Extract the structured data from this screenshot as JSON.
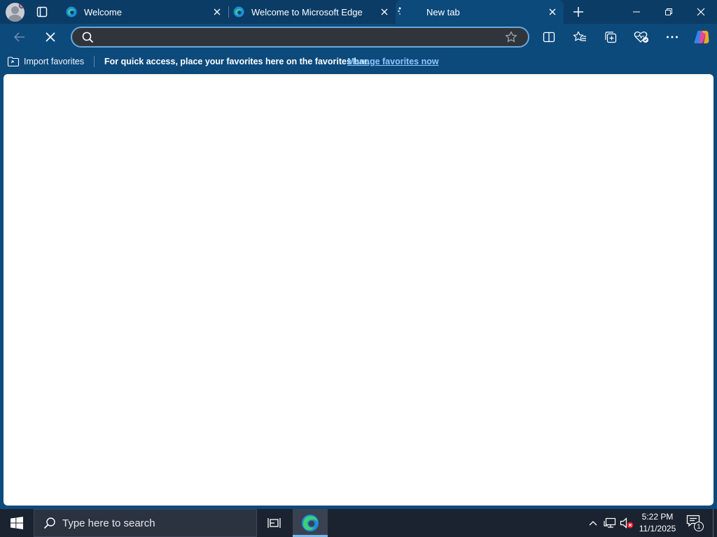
{
  "tabs": [
    {
      "title": "Welcome",
      "icon": "edge-logo-icon",
      "active": false
    },
    {
      "title": "Welcome to Microsoft Edge",
      "icon": "edge-logo-icon",
      "active": false
    },
    {
      "title": "New tab",
      "icon": "loading-spinner-icon",
      "active": true
    }
  ],
  "toolbar": {
    "address_value": "",
    "address_placeholder": ""
  },
  "favorites_bar": {
    "import_label": "Import favorites",
    "message": "For quick access, place your favorites here on the favorites bar.",
    "manage_link": "Manage favorites now"
  },
  "taskbar": {
    "search_placeholder": "Type here to search",
    "time": "5:22 PM",
    "date": "11/1/2025",
    "notification_count": "1"
  },
  "colors": {
    "frame": "#0b3c66",
    "toolbar": "#0d4a7c",
    "address_border": "#6aa7dc",
    "link": "#8cc8ff",
    "taskbar": "#1c2330"
  }
}
